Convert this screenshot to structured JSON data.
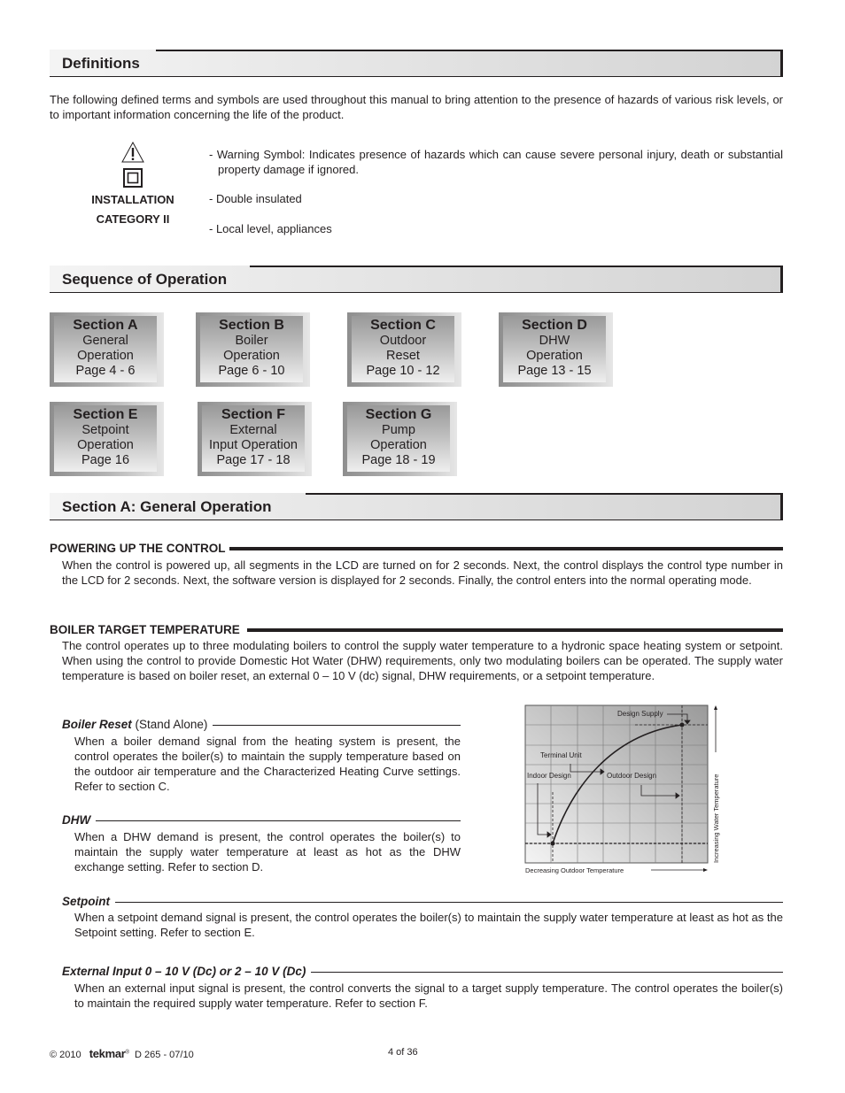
{
  "definitions": {
    "title": "Definitions",
    "intro": "The following defined terms and symbols are used throughout this manual to bring attention to the presence of hazards of various risk levels, or to important information concerning the life of the product.",
    "category_line1": "INSTALLATION",
    "category_line2": "CATEGORY II",
    "items": [
      {
        "icon": "warning-triangle-icon",
        "text": "- Warning Symbol: Indicates presence of hazards which can cause severe personal injury, death or substantial property damage if ignored."
      },
      {
        "icon": "double-insulated-icon",
        "text": "- Double insulated"
      },
      {
        "icon": "installation-category",
        "text": "- Local level, appliances"
      }
    ]
  },
  "sequence": {
    "title": "Sequence of Operation",
    "sections": [
      {
        "title": "Section A",
        "lines": [
          "General",
          "Operation",
          "Page 4 - 6"
        ]
      },
      {
        "title": "Section B",
        "lines": [
          "Boiler",
          "Operation",
          "Page 6 - 10"
        ]
      },
      {
        "title": "Section C",
        "lines": [
          "Outdoor",
          "Reset",
          "Page 10 - 12"
        ]
      },
      {
        "title": "Section D",
        "lines": [
          "DHW",
          "Operation",
          "Page 13 - 15"
        ]
      },
      {
        "title": "Section E",
        "lines": [
          "Setpoint",
          "Operation",
          "Page 16"
        ]
      },
      {
        "title": "Section F",
        "lines": [
          "External",
          "Input Operation",
          "Page 17 - 18"
        ]
      },
      {
        "title": "Section G",
        "lines": [
          "Pump",
          "Operation",
          "Page 18 - 19"
        ]
      }
    ]
  },
  "section_a": {
    "title": "Section A: General Operation",
    "powering_up": {
      "heading": "POWERING UP THE CONTROL",
      "text": "When the control is powered up, all segments in the LCD are turned on for 2 seconds. Next, the control displays the control type number in the LCD for 2 seconds. Next, the software version is displayed for 2 seconds. Finally, the control enters into the normal operating mode."
    },
    "boiler_target": {
      "heading": "BOILER TARGET TEMPERATURE",
      "text": "The control operates up to three modulating boilers to control the supply water temperature to a hydronic space heating system or setpoint. When using the control to provide Domestic Hot Water (DHW) requirements, only two modulating boilers can be operated. The supply water temperature is based on boiler reset, an external 0 – 10 V (dc) signal, DHW requirements, or a setpoint temperature."
    },
    "boiler_reset": {
      "heading_bold": "Boiler Reset",
      "heading_rest": " (Stand Alone)",
      "text": "When a boiler demand signal from the heating system is present, the control operates the boiler(s) to maintain the supply temperature based on the outdoor air temperature and the Characterized Heating Curve settings. Refer to section C."
    },
    "dhw": {
      "heading_bold": "DHW",
      "text": "When a DHW demand is present, the control operates the boiler(s) to maintain the supply water temperature at least as hot as the DHW exchange setting. Refer to section D."
    },
    "setpoint": {
      "heading_bold": "Setpoint",
      "text": "When a setpoint demand signal is present, the control operates the boiler(s) to maintain the supply water temperature at least as hot as the Setpoint setting. Refer to section E."
    },
    "external_input": {
      "heading_bold": "External Input 0 – 10 V (Dc) or 2 – 10 V (Dc)",
      "text": "When an external input signal is present, the control converts the signal to a target supply temperature. The control operates the boiler(s) to maintain the required supply water temperature. Refer to section F."
    }
  },
  "diagram": {
    "labels": {
      "design_supply": "Design Supply",
      "terminal_unit": "Terminal Unit",
      "indoor_design": "Indoor Design",
      "outdoor_design": "Outdoor Design",
      "x_axis": "Decreasing Outdoor Temperature",
      "y_axis": "Increasing Water Temperature"
    }
  },
  "footer": {
    "copyright": "© 2010",
    "brand": "tekmar",
    "doc_code": "D 265 - 07/10",
    "page": "4 of 36"
  }
}
